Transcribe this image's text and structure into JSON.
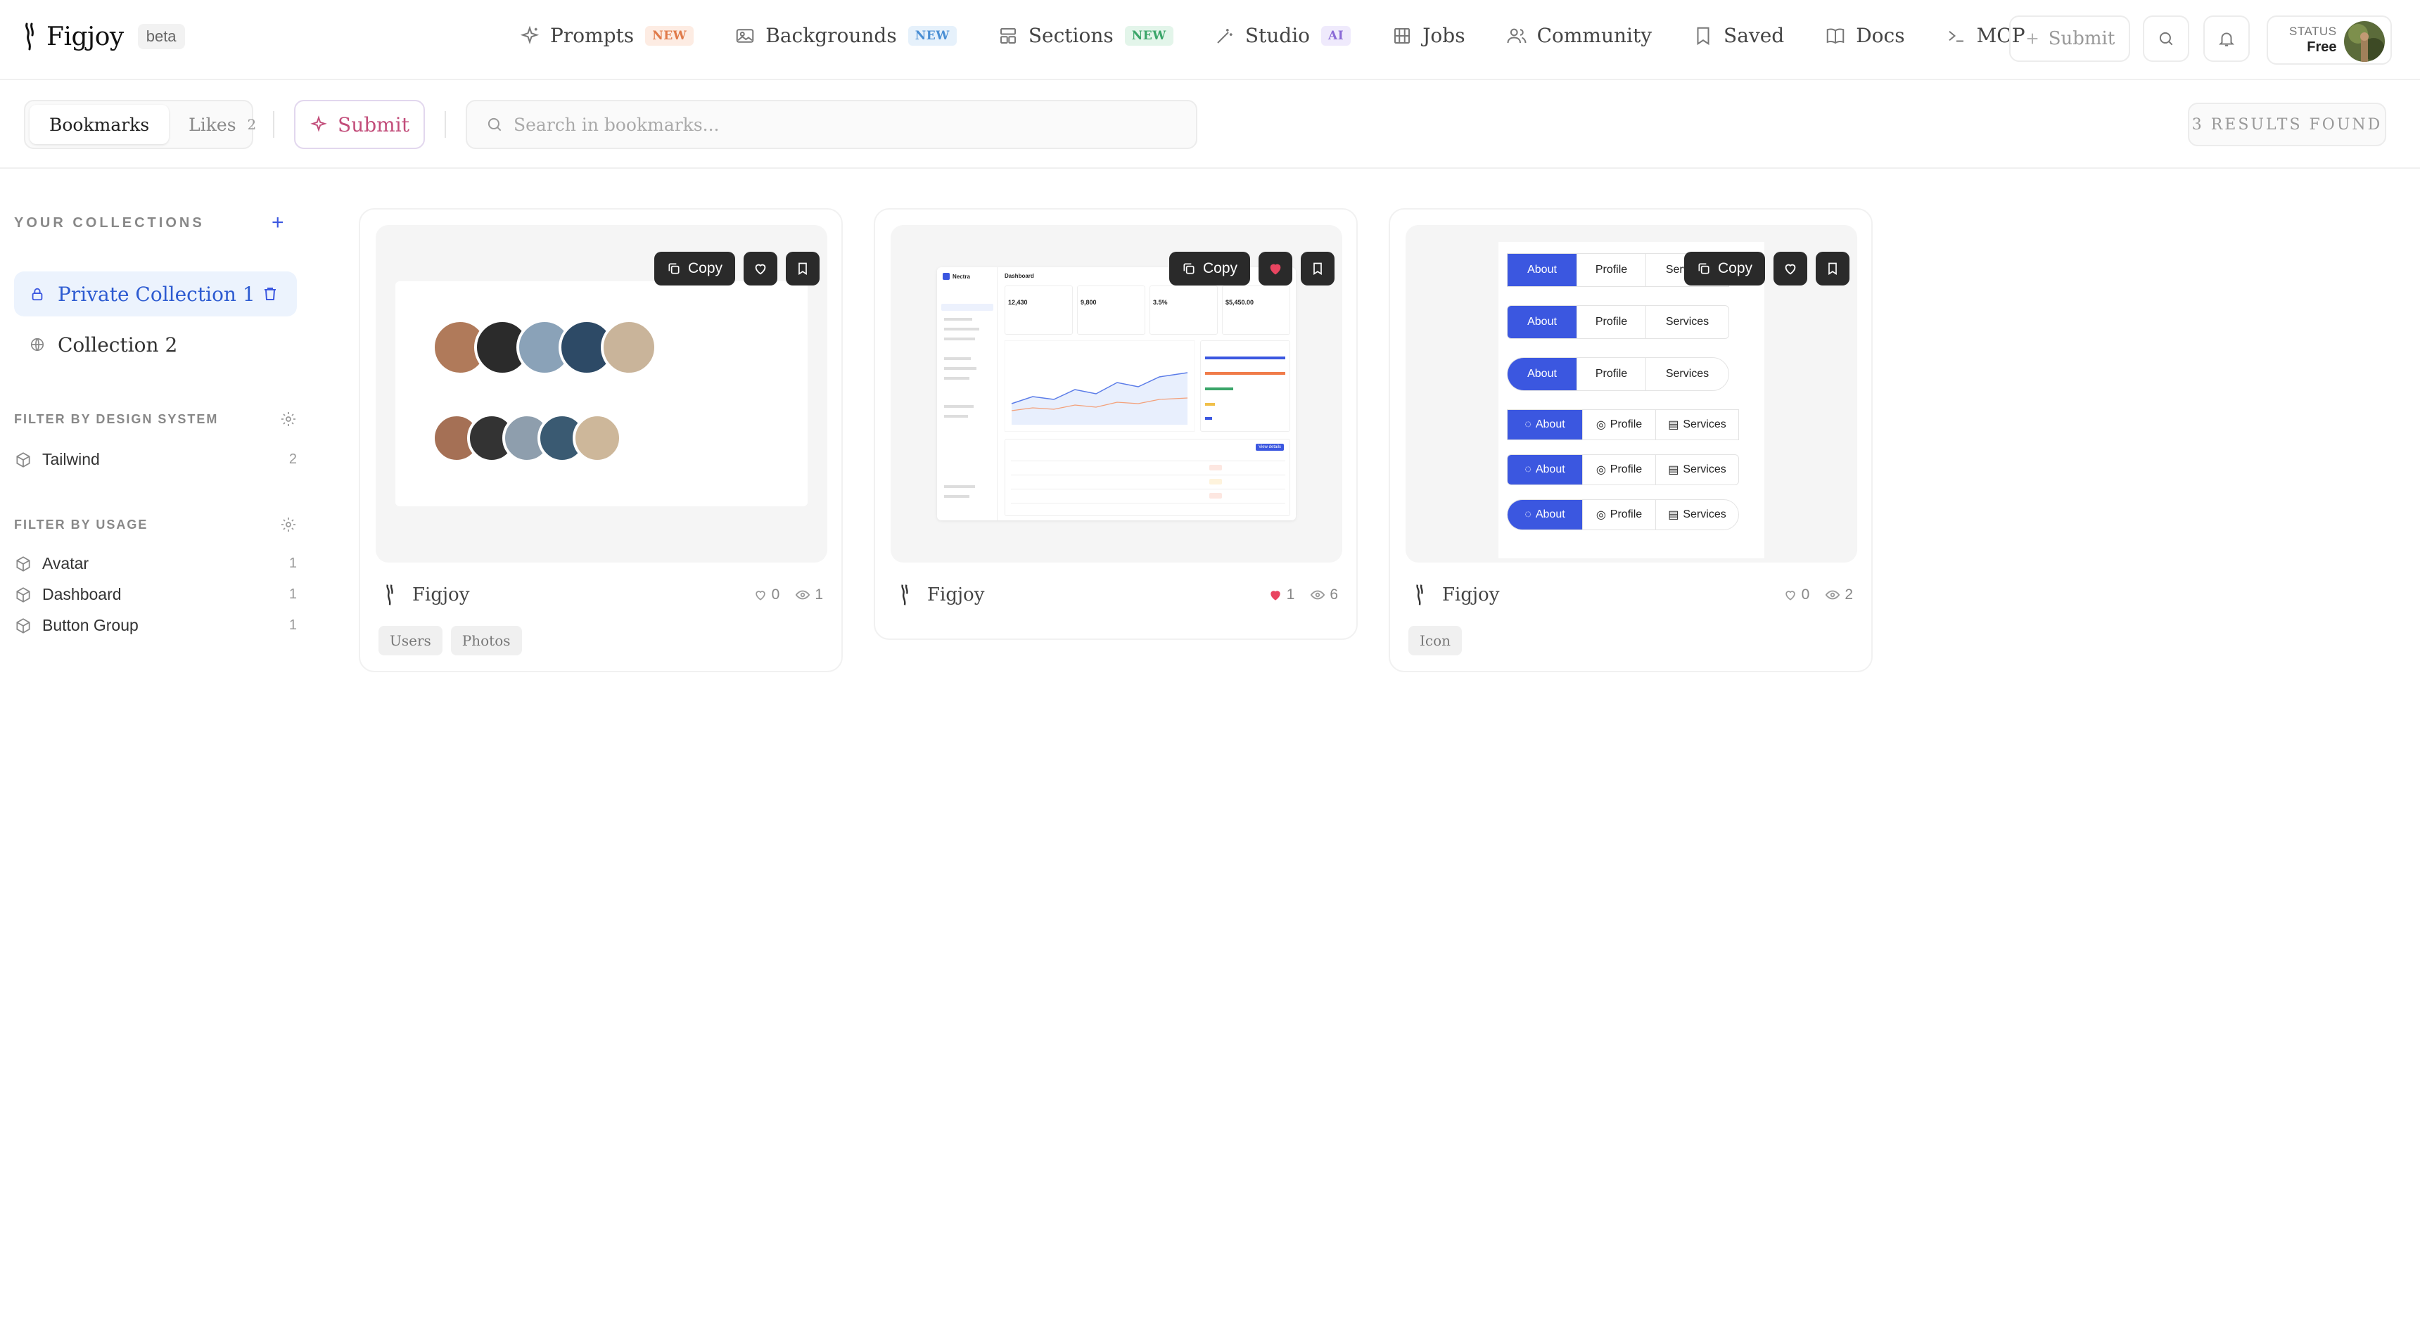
{
  "header": {
    "logo": "Figjoy",
    "beta_badge": "beta",
    "nav": [
      {
        "label": "Prompts",
        "badge": "NEW",
        "icon": "sparkle-icon"
      },
      {
        "label": "Backgrounds",
        "badge": "NEW",
        "icon": "image-icon"
      },
      {
        "label": "Sections",
        "badge": "NEW",
        "icon": "layout-icon"
      },
      {
        "label": "Studio",
        "badge": "AI",
        "icon": "wand-icon"
      },
      {
        "label": "Jobs",
        "badge": "",
        "icon": "building-icon"
      },
      {
        "label": "Community",
        "badge": "",
        "icon": "users-icon"
      },
      {
        "label": "Saved",
        "badge": "",
        "icon": "bookmark-icon"
      },
      {
        "label": "Docs",
        "badge": "",
        "icon": "book-icon"
      },
      {
        "label": "MCP",
        "badge": "",
        "icon": "terminal-icon"
      }
    ],
    "submit_label": "Submit",
    "status_label": "STATUS",
    "status_value": "Free"
  },
  "toolbar": {
    "tabs": [
      {
        "label": "Bookmarks",
        "count": ""
      },
      {
        "label": "Likes",
        "count": "2"
      }
    ],
    "submit_label": "Submit",
    "search_placeholder": "Search in bookmarks...",
    "results": "3 RESULTS FOUND"
  },
  "sidebar": {
    "collections_title": "YOUR COLLECTIONS",
    "collections": [
      {
        "label": "Private Collection 1",
        "icon": "lock-icon",
        "active": true
      },
      {
        "label": "Collection 2",
        "icon": "globe-icon",
        "active": false
      }
    ],
    "design_system_title": "FILTER BY DESIGN SYSTEM",
    "design_systems": [
      {
        "label": "Tailwind",
        "count": "2",
        "icon": "cube-icon"
      }
    ],
    "usage_title": "FILTER BY USAGE",
    "usages": [
      {
        "label": "Avatar",
        "count": "1",
        "icon": "cube-icon"
      },
      {
        "label": "Dashboard",
        "count": "1",
        "icon": "cube-icon"
      },
      {
        "label": "Button Group",
        "count": "1",
        "icon": "cube-icon"
      }
    ]
  },
  "cards": [
    {
      "author": "Figjoy",
      "likes": "0",
      "views": "1",
      "liked": false,
      "tags": [
        "Users",
        "Photos"
      ],
      "copy_label": "Copy"
    },
    {
      "author": "Figjoy",
      "likes": "1",
      "views": "6",
      "liked": true,
      "tags": [],
      "copy_label": "Copy"
    },
    {
      "author": "Figjoy",
      "likes": "0",
      "views": "2",
      "liked": false,
      "tags": [
        "Icon"
      ],
      "copy_label": "Copy"
    }
  ],
  "preview_dashboard": {
    "brand": "Nectra",
    "title": "Dashboard",
    "kpis": [
      "12,430",
      "9,800",
      "3.5%",
      "$5,450.00"
    ],
    "button": "View details"
  },
  "preview_buttons": {
    "labels": [
      "About",
      "Profile",
      "Services"
    ]
  },
  "colors": {
    "accent": "#3b57e0",
    "like": "#e94560",
    "submit": "#c24d7a"
  }
}
